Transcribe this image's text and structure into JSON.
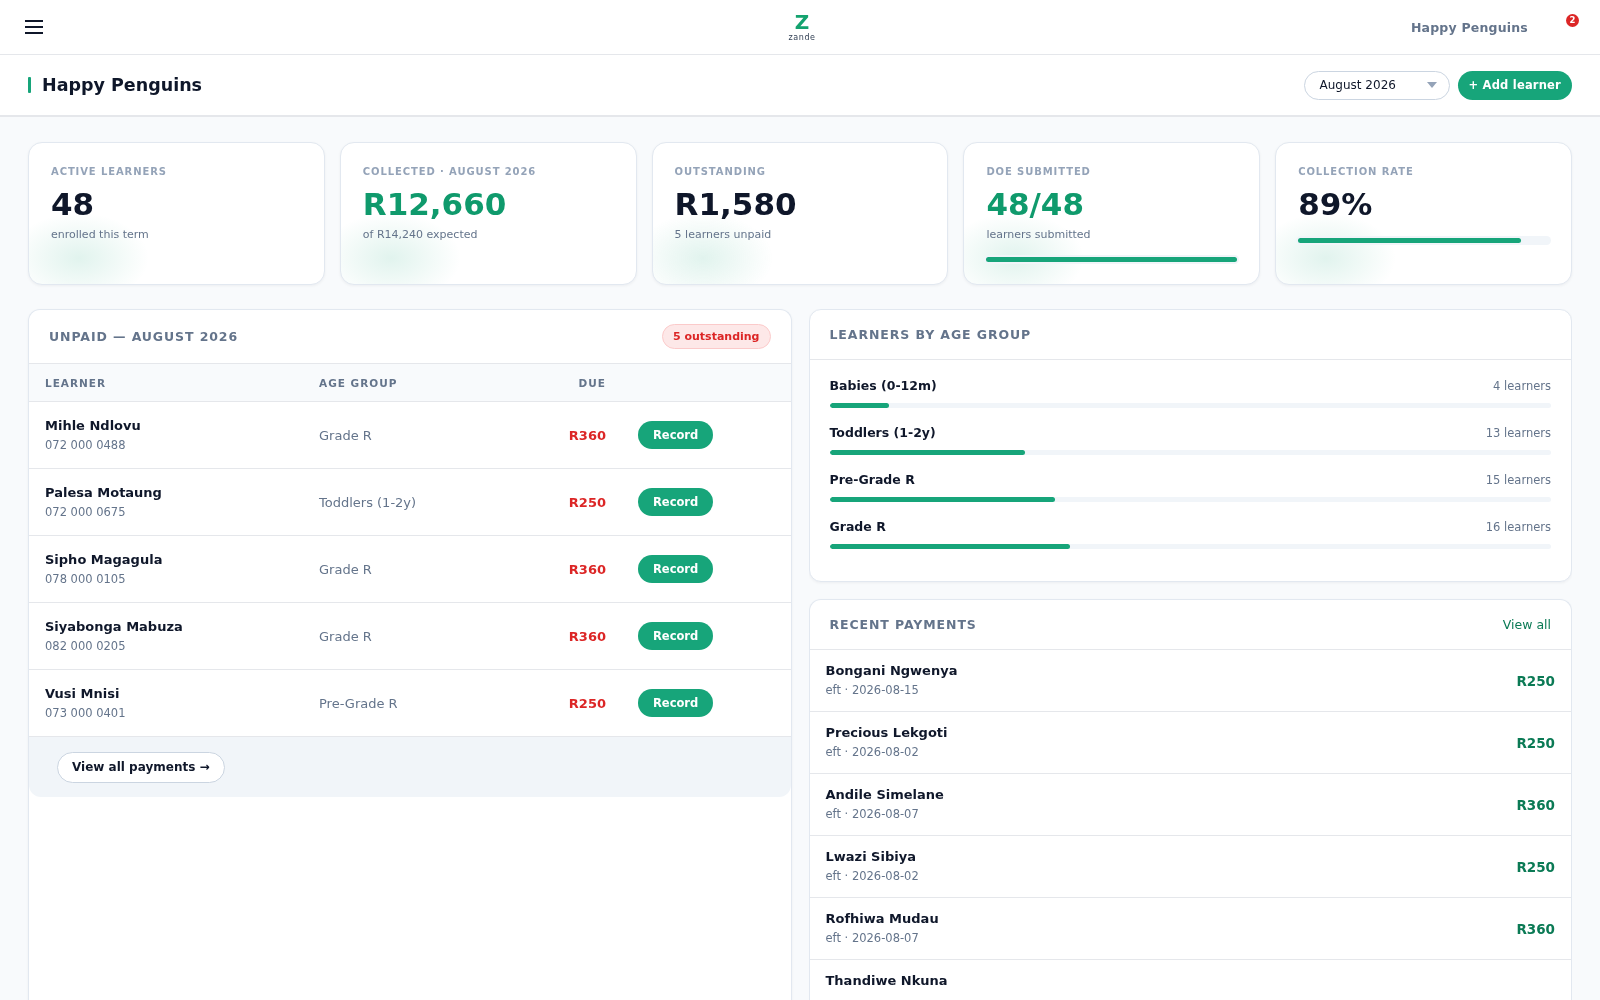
{
  "top_bar": {
    "logo": {
      "mark": "Z",
      "wordmark": "zande"
    },
    "school_name": "Happy Penguins",
    "notification_count": "2"
  },
  "header": {
    "title": "Happy Penguins",
    "month_select": {
      "value": "August 2026"
    },
    "add_button": "+ Add learner"
  },
  "stats": [
    {
      "label": "ACTIVE LEARNERS",
      "value": "48",
      "accent": false,
      "note": "enrolled this term"
    },
    {
      "label": "COLLECTED · AUGUST 2026",
      "value": "R12,660",
      "accent": true,
      "note": "of R14,240 expected"
    },
    {
      "label": "OUTSTANDING",
      "value": "R1,580",
      "accent": false,
      "note": "5 learners unpaid"
    },
    {
      "label": "DOE SUBMITTED",
      "value": "48/48",
      "accent": true,
      "note": "learners submitted",
      "level": 1
    },
    {
      "label": "COLLECTION RATE",
      "value": "89%",
      "accent": false,
      "level": 0.89
    }
  ],
  "unpaid": {
    "title": "UNPAID — AUGUST 2026",
    "badge": "5 outstanding",
    "columns": [
      "LEARNER",
      "AGE GROUP",
      "DUE"
    ],
    "rows": [
      {
        "name": "Mihle Ndlovu",
        "phone": "072 000 0488",
        "age_group": "Grade R",
        "due": "R360",
        "action": "Record"
      },
      {
        "name": "Palesa Motaung",
        "phone": "072 000 0675",
        "age_group": "Toddlers (1-2y)",
        "due": "R250",
        "action": "Record"
      },
      {
        "name": "Sipho Magagula",
        "phone": "078 000 0105",
        "age_group": "Grade R",
        "due": "R360",
        "action": "Record"
      },
      {
        "name": "Siyabonga Mabuza",
        "phone": "082 000 0205",
        "age_group": "Grade R",
        "due": "R360",
        "action": "Record"
      },
      {
        "name": "Vusi Mnisi",
        "phone": "073 000 0401",
        "age_group": "Pre-Grade R",
        "due": "R250",
        "action": "Record"
      }
    ],
    "footer_button": "View all payments →"
  },
  "age_groups": {
    "title": "LEARNERS BY AGE GROUP",
    "groups": [
      {
        "name": "Babies (0-12m)",
        "count": "4 learners",
        "level": 0.083
      },
      {
        "name": "Toddlers (1-2y)",
        "count": "13 learners",
        "level": 0.271
      },
      {
        "name": "Pre-Grade R",
        "count": "15 learners",
        "level": 0.3125
      },
      {
        "name": "Grade R",
        "count": "16 learners",
        "level": 0.333
      }
    ]
  },
  "recent_payments": {
    "title": "RECENT PAYMENTS",
    "link": "View all",
    "payments": [
      {
        "name": "Bongani Ngwenya",
        "meta": "eft · 2026-08-15",
        "amount": "R250"
      },
      {
        "name": "Precious Lekgoti",
        "meta": "eft · 2026-08-02",
        "amount": "R250"
      },
      {
        "name": "Andile Simelane",
        "meta": "eft · 2026-08-07",
        "amount": "R360"
      },
      {
        "name": "Lwazi Sibiya",
        "meta": "eft · 2026-08-02",
        "amount": "R250"
      },
      {
        "name": "Rofhiwa Mudau",
        "meta": "eft · 2026-08-07",
        "amount": "R360"
      },
      {
        "name": "Thandiwe Nkuna"
      }
    ]
  }
}
